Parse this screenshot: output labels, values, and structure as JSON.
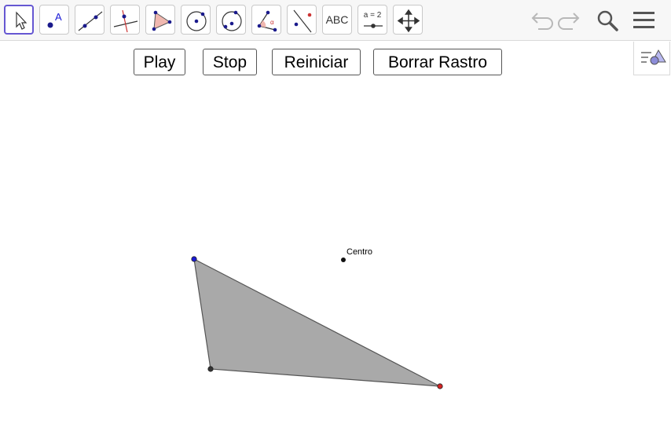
{
  "toolbar": {
    "tools": [
      {
        "name": "move-tool",
        "active": true
      },
      {
        "name": "point-tool"
      },
      {
        "name": "line-tool"
      },
      {
        "name": "perpendicular-line-tool"
      },
      {
        "name": "polygon-tool"
      },
      {
        "name": "circle-center-point-tool"
      },
      {
        "name": "circle-three-points-tool"
      },
      {
        "name": "angle-tool"
      },
      {
        "name": "reflect-about-line-tool"
      },
      {
        "name": "text-tool",
        "label": "ABC"
      },
      {
        "name": "slider-tool",
        "label": "a = 2"
      },
      {
        "name": "move-graphics-view-tool"
      }
    ],
    "header": [
      "undo-icon",
      "redo-icon",
      "search-icon",
      "menu-icon"
    ]
  },
  "buttons": {
    "play": "Play",
    "stop": "Stop",
    "reset": "Reiniciar",
    "clear_trace": "Borrar Rastro"
  },
  "graphics": {
    "point_label": "Centro",
    "polygon_fill": "#a9a9a9",
    "vertex_colors": [
      "#1a1ad6",
      "#333333",
      "#d42424"
    ]
  }
}
